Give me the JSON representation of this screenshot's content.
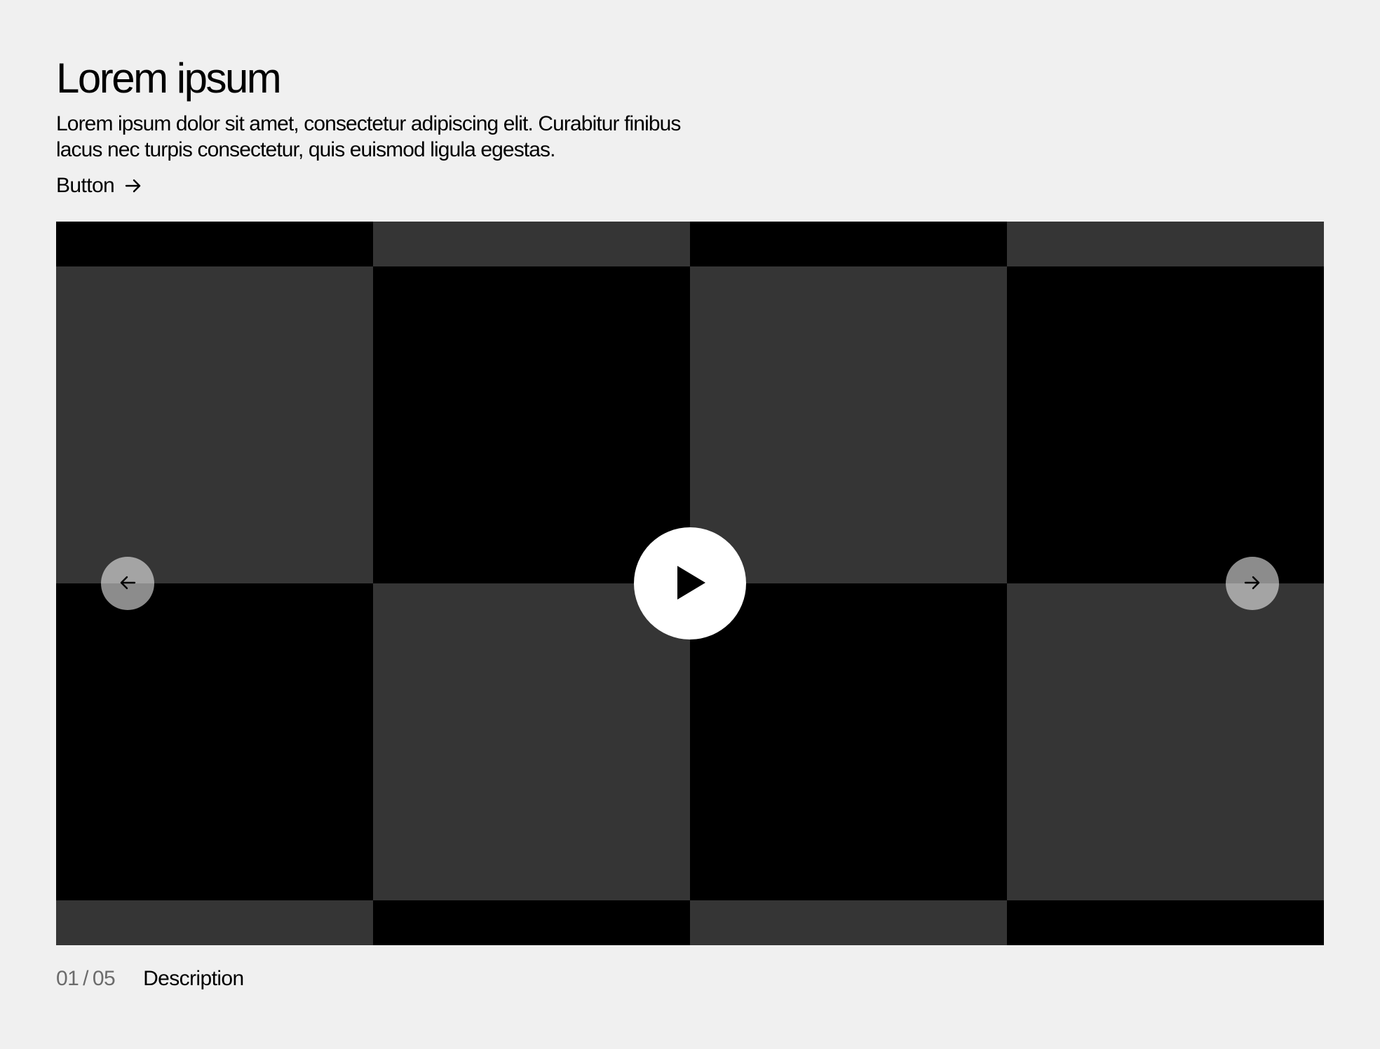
{
  "header": {
    "title": "Lorem ipsum",
    "description": "Lorem ipsum dolor sit amet, consectetur adipiscing elit. Curabitur finibus lacus nec turpis consectetur, quis euismod ligula egestas.",
    "button_label": "Button"
  },
  "media": {
    "colors": {
      "dark_tile": "#000000",
      "gray_tile": "#353535",
      "play_button": "#ffffff",
      "arrow_button": "#ffffff8c"
    },
    "icons": {
      "play": "play-icon",
      "prev": "arrow-left-icon",
      "next": "arrow-right-icon"
    }
  },
  "caption": {
    "current": "01",
    "separator": "/",
    "total": "05",
    "description": "Description"
  },
  "colors": {
    "background": "#f0f0f0",
    "text": "#000000",
    "muted_text": "#6b6b6b"
  }
}
